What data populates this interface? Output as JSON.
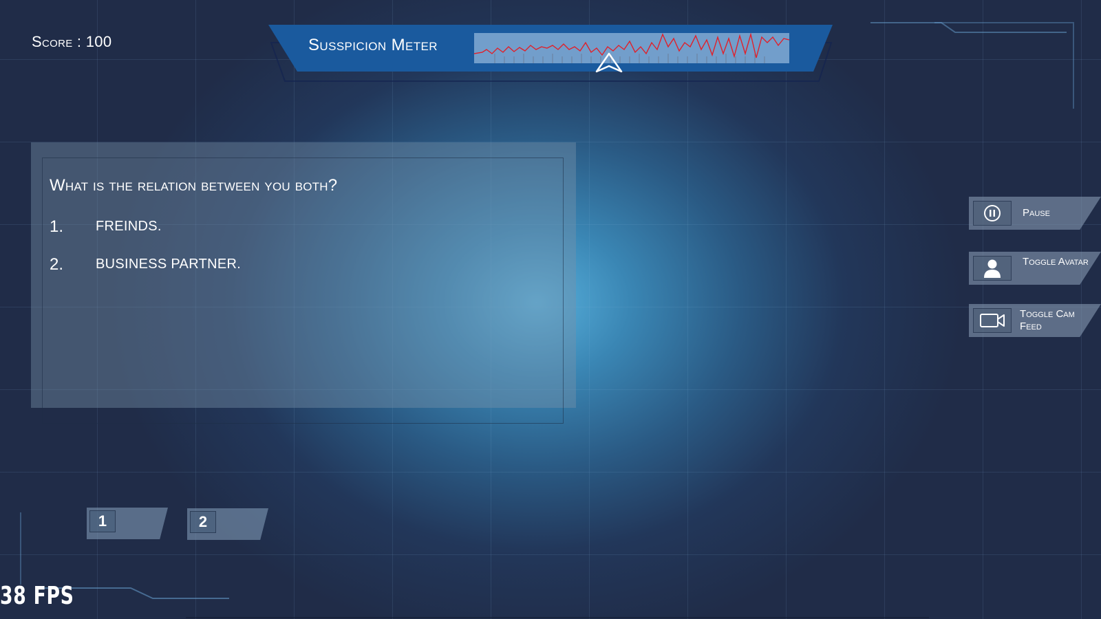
{
  "hud": {
    "score_label": "Score : 100",
    "fps_label": "38 FPS"
  },
  "meter": {
    "title": "Susspicion Meter",
    "line_color": "#e0202a",
    "indicator": "arrow-up-icon"
  },
  "question": {
    "text": "What is the relation between you both?",
    "options": [
      {
        "number": "1.",
        "text": "FREINDS."
      },
      {
        "number": "2.",
        "text": "BUSINESS PARTNER."
      }
    ]
  },
  "answer_buttons": [
    {
      "label": "1"
    },
    {
      "label": "2"
    }
  ],
  "side_buttons": {
    "pause": {
      "label": "Pause",
      "icon": "pause-icon"
    },
    "avatar": {
      "label": "Toggle Avatar",
      "icon": "person-icon"
    },
    "cam": {
      "label": "Toggle Cam Feed",
      "icon": "video-camera-icon"
    }
  }
}
